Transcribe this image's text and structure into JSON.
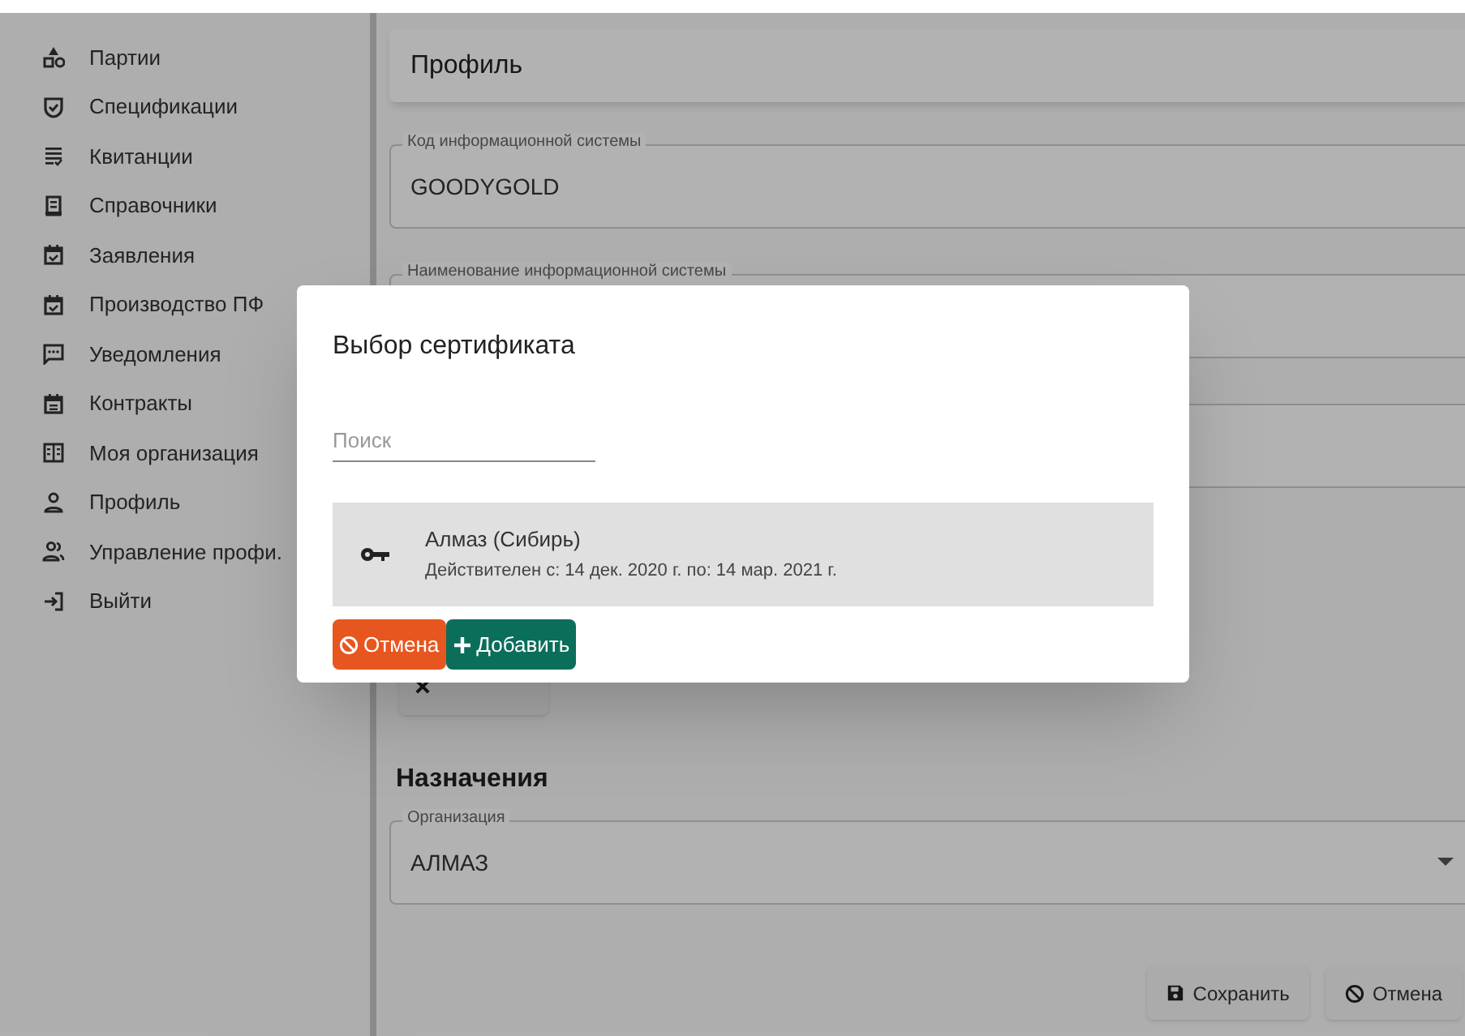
{
  "sidebar": {
    "items": [
      {
        "label": "Партии"
      },
      {
        "label": "Спецификации"
      },
      {
        "label": "Квитанции"
      },
      {
        "label": "Справочники"
      },
      {
        "label": "Заявления"
      },
      {
        "label": "Производство ПФ"
      },
      {
        "label": "Уведомления"
      },
      {
        "label": "Контракты"
      },
      {
        "label": "Моя организация"
      },
      {
        "label": "Профиль"
      },
      {
        "label": "Управление профи."
      },
      {
        "label": "Выйти"
      }
    ]
  },
  "page": {
    "title": "Профиль",
    "fields": [
      {
        "label": "Код информационной системы",
        "value": "GOODYGOLD"
      },
      {
        "label": "Наименование информационной системы"
      }
    ],
    "assignments_heading": "Назначения",
    "organization_field": {
      "label": "Организация",
      "value": "АЛМАЗ"
    },
    "buttons": [
      {
        "kind": "save",
        "label": "Сохранить"
      },
      {
        "kind": "cancel",
        "label": "Отмена"
      }
    ]
  },
  "dialog": {
    "title": "Выбор сертификата",
    "search": {
      "placeholder": "Поиск"
    },
    "certificates": [
      {
        "name": "Алмаз (Сибирь)",
        "validity": "Действителен с: 14 дек. 2020 г. по: 14 мар. 2021 г."
      }
    ],
    "buttons": [
      {
        "kind": "cancel",
        "label": "Отмена"
      },
      {
        "kind": "add",
        "label": "Добавить"
      }
    ]
  }
}
